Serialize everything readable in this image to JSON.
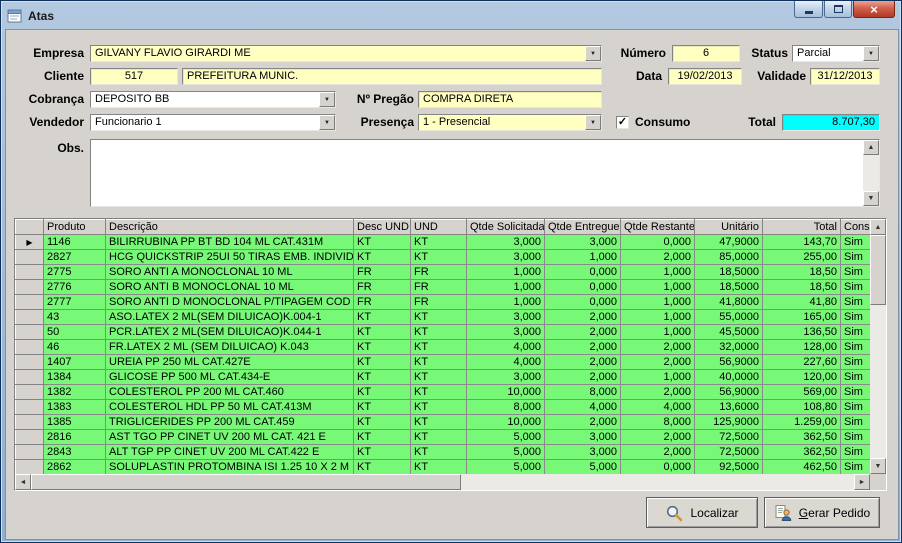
{
  "window": {
    "title": "Atas"
  },
  "icons": {
    "dropdown": "▼",
    "scroll_up": "▲",
    "scroll_down": "▼",
    "scroll_left": "◄",
    "scroll_right": "►",
    "row_pointer": "▶",
    "checkmark": "✓",
    "close_glyph": "×"
  },
  "colors": {
    "field_yellow": "#FFFFC2",
    "total_cyan": "#00FFFF",
    "grid_row_green": "#77F877",
    "chrome_blue": "#8FB0D2"
  },
  "form": {
    "labels": {
      "empresa": "Empresa",
      "cliente": "Cliente",
      "cobranca": "Cobrança",
      "vendedor": "Vendedor",
      "obs": "Obs.",
      "numero": "Número",
      "status": "Status",
      "data": "Data",
      "validade": "Validade",
      "pregao": "Nº Pregão",
      "presenca": "Presença",
      "consumo": "Consumo",
      "total": "Total"
    },
    "values": {
      "empresa": "GILVANY FLAVIO GIRARDI ME",
      "numero": "6",
      "status": "Parcial",
      "cliente_codigo": "517",
      "cliente_nome": "PREFEITURA MUNIC.",
      "data": "19/02/2013",
      "validade": "31/12/2013",
      "cobranca": "DEPOSITO BB",
      "pregao": "COMPRA DIRETA",
      "vendedor": "Funcionario 1",
      "presenca": "1 - Presencial",
      "consumo_checked": true,
      "total": "8.707,30",
      "obs": ""
    }
  },
  "grid": {
    "columns": [
      "Produto",
      "Descrição",
      "Desc UND",
      "UND",
      "Qtde Solicitada",
      "Qtde Entregue",
      "Qtde Restante",
      "Unitário",
      "Total",
      "Consu"
    ],
    "rows": [
      [
        "1146",
        "BILIRRUBINA PP BT BD 104 ML CAT.431M",
        "KT",
        "KT",
        "3,000",
        "3,000",
        "0,000",
        "47,9000",
        "143,70",
        "Sim"
      ],
      [
        "2827",
        "HCG QUICKSTRIP 25UI 50 TIRAS EMB. INDIVID",
        "KT",
        "KT",
        "3,000",
        "1,000",
        "2,000",
        "85,0000",
        "255,00",
        "Sim"
      ],
      [
        "2775",
        "SORO ANTI A MONOCLONAL 10 ML",
        "FR",
        "FR",
        "1,000",
        "0,000",
        "1,000",
        "18,5000",
        "18,50",
        "Sim"
      ],
      [
        "2776",
        "SORO ANTI B MONOCLONAL 10 ML",
        "FR",
        "FR",
        "1,000",
        "0,000",
        "1,000",
        "18,5000",
        "18,50",
        "Sim"
      ],
      [
        "2777",
        "SORO ANTI D MONOCLONAL P/TIPAGEM COD",
        "FR",
        "FR",
        "1,000",
        "0,000",
        "1,000",
        "41,8000",
        "41,80",
        "Sim"
      ],
      [
        "43",
        "ASO.LATEX 2 ML(SEM DILUICAO)K.004-1",
        "KT",
        "KT",
        "3,000",
        "2,000",
        "1,000",
        "55,0000",
        "165,00",
        "Sim"
      ],
      [
        "50",
        "PCR.LATEX 2 ML(SEM DILUICAO)K.044-1",
        "KT",
        "KT",
        "3,000",
        "2,000",
        "1,000",
        "45,5000",
        "136,50",
        "Sim"
      ],
      [
        "46",
        "FR.LATEX 2 ML (SEM DILUICAO) K.043",
        "KT",
        "KT",
        "4,000",
        "2,000",
        "2,000",
        "32,0000",
        "128,00",
        "Sim"
      ],
      [
        "1407",
        "UREIA PP 250 ML CAT.427E",
        "KT",
        "KT",
        "4,000",
        "2,000",
        "2,000",
        "56,9000",
        "227,60",
        "Sim"
      ],
      [
        "1384",
        "GLICOSE PP 500 ML CAT.434-E",
        "KT",
        "KT",
        "3,000",
        "2,000",
        "1,000",
        "40,0000",
        "120,00",
        "Sim"
      ],
      [
        "1382",
        "COLESTEROL PP 200 ML CAT.460",
        "KT",
        "KT",
        "10,000",
        "8,000",
        "2,000",
        "56,9000",
        "569,00",
        "Sim"
      ],
      [
        "1383",
        "COLESTEROL HDL PP 50 ML CAT.413M",
        "KT",
        "KT",
        "8,000",
        "4,000",
        "4,000",
        "13,6000",
        "108,80",
        "Sim"
      ],
      [
        "1385",
        "TRIGLICERIDES PP 200 ML CAT.459",
        "KT",
        "KT",
        "10,000",
        "2,000",
        "8,000",
        "125,9000",
        "1.259,00",
        "Sim"
      ],
      [
        "2816",
        "AST TGO PP CINET UV 200 ML CAT. 421 E",
        "KT",
        "KT",
        "5,000",
        "3,000",
        "2,000",
        "72,5000",
        "362,50",
        "Sim"
      ],
      [
        "2843",
        "ALT TGP PP CINET UV 200 ML CAT.422 E",
        "KT",
        "KT",
        "5,000",
        "3,000",
        "2,000",
        "72,5000",
        "362,50",
        "Sim"
      ],
      [
        "2862",
        "SOLUPLASTIN PROTOMBINA ISI 1.25 10 X 2 M",
        "KT",
        "KT",
        "5,000",
        "5,000",
        "0,000",
        "92,5000",
        "462,50",
        "Sim"
      ]
    ]
  },
  "buttons": {
    "localizar": "Localizar",
    "gerar_pedido": "Gerar Pedido"
  }
}
